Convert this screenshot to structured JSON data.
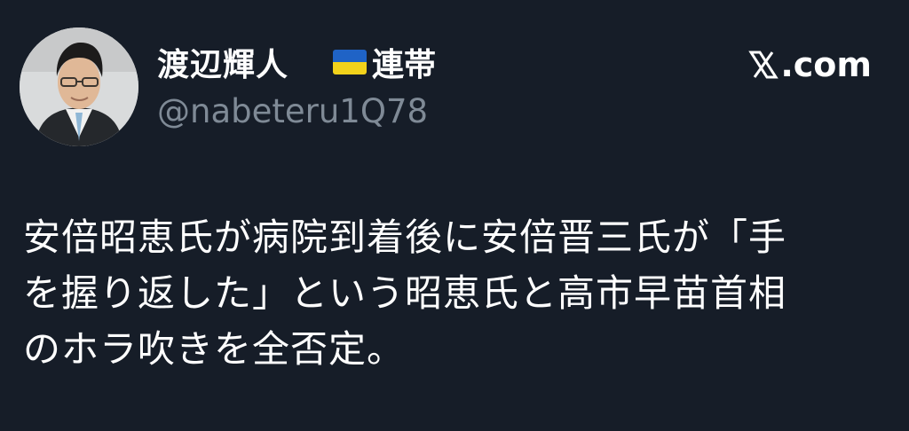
{
  "author": {
    "display_name": "渡辺輝人",
    "flag_icon": "ukraine-flag-icon",
    "name_suffix": "連帯",
    "handle": "@nabeteru1Q78",
    "avatar_icon": "profile-avatar-icon"
  },
  "brand": {
    "logo_icon": "x-logo-icon",
    "label": ".com"
  },
  "tweet": {
    "lines": [
      "安倍昭恵氏が病院到着後に安倍晋三氏が「手",
      "を握り返した」という昭恵氏と高市早苗首相",
      "のホラ吹きを全否定。"
    ]
  },
  "colors": {
    "background": "#161d28",
    "text": "#ffffff",
    "handle": "#7f8a96",
    "flag_blue": "#1f63c6",
    "flag_yellow": "#f2d21b"
  }
}
